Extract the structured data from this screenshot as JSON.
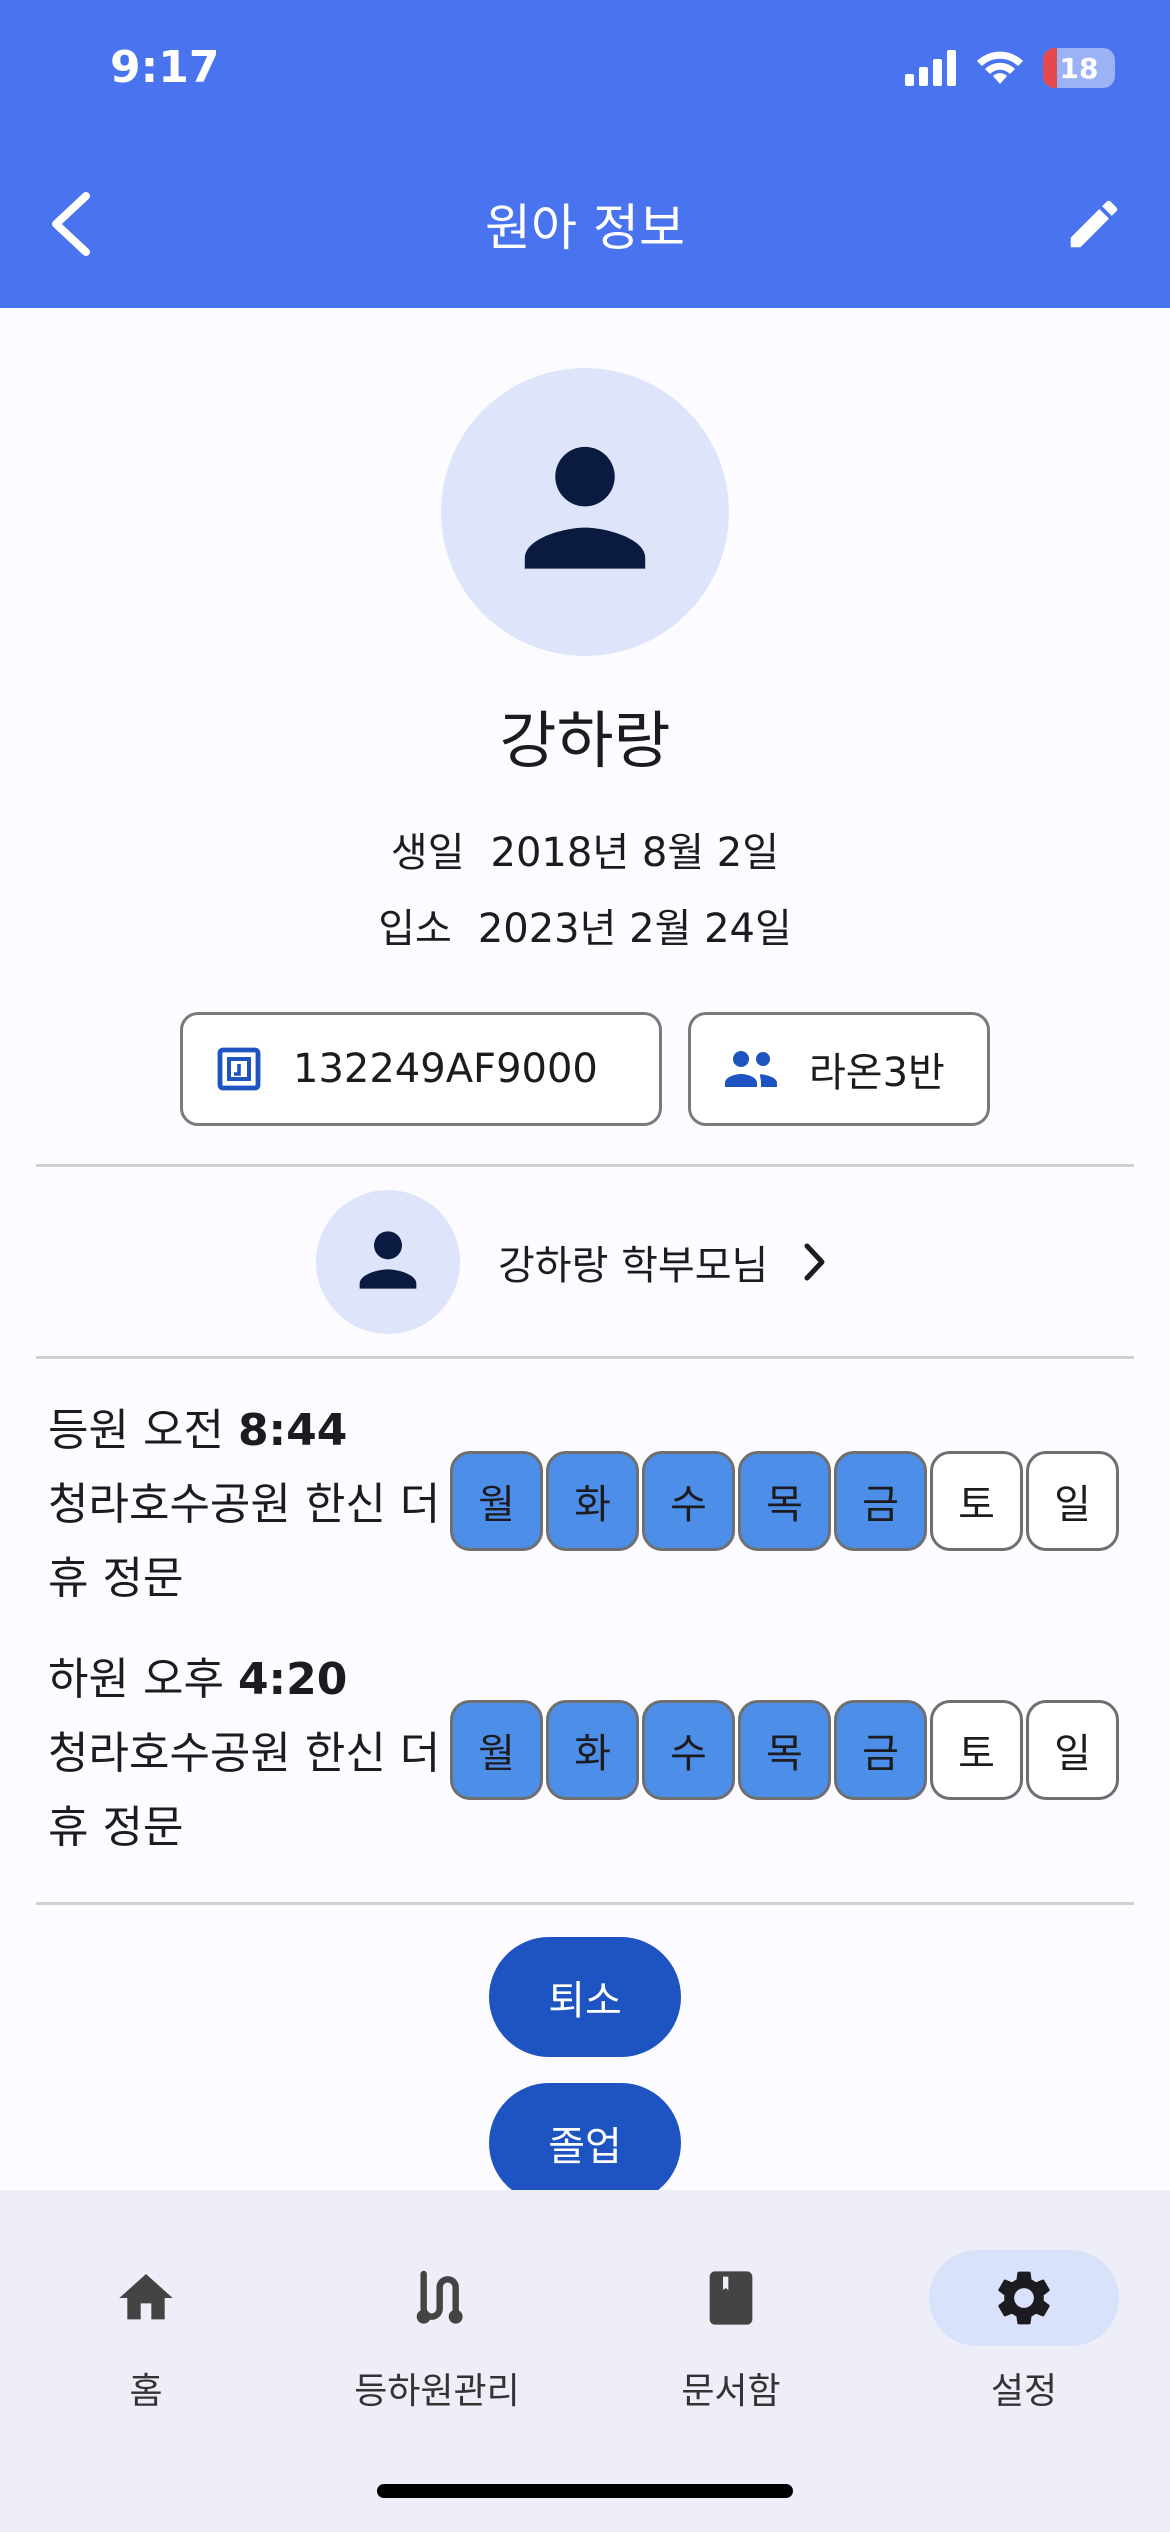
{
  "status_bar": {
    "time": "9:17",
    "battery": "18"
  },
  "header": {
    "title": "원아 정보"
  },
  "child": {
    "name": "강하랑",
    "birthday_label": "생일",
    "birthday": "2018년 8월 2일",
    "enroll_label": "입소",
    "enroll_date": "2023년 2월 24일",
    "tag_id": "132249AF9000",
    "class_name": "라온3반"
  },
  "parent": {
    "name": "강하랑 학부모님"
  },
  "schedules": [
    {
      "type": "등원",
      "period": "오전",
      "time": "8:44",
      "location": "청라호수공원 한신 더휴 정문",
      "days": [
        {
          "label": "월",
          "active": true
        },
        {
          "label": "화",
          "active": true
        },
        {
          "label": "수",
          "active": true
        },
        {
          "label": "목",
          "active": true
        },
        {
          "label": "금",
          "active": true
        },
        {
          "label": "토",
          "active": false
        },
        {
          "label": "일",
          "active": false
        }
      ]
    },
    {
      "type": "하원",
      "period": "오후",
      "time": "4:20",
      "location": "청라호수공원 한신 더휴 정문",
      "days": [
        {
          "label": "월",
          "active": true
        },
        {
          "label": "화",
          "active": true
        },
        {
          "label": "수",
          "active": true
        },
        {
          "label": "목",
          "active": true
        },
        {
          "label": "금",
          "active": true
        },
        {
          "label": "토",
          "active": false
        },
        {
          "label": "일",
          "active": false
        }
      ]
    }
  ],
  "actions": {
    "leave_label": "퇴소",
    "graduate_label": "졸업"
  },
  "bottom_nav": [
    {
      "label": "홈",
      "icon": "home-icon",
      "active": false
    },
    {
      "label": "등하원관리",
      "icon": "route-icon",
      "active": false
    },
    {
      "label": "문서함",
      "icon": "book-icon",
      "active": false
    },
    {
      "label": "설정",
      "icon": "gear-icon",
      "active": true
    }
  ],
  "colors": {
    "primary": "#4a74ef",
    "button": "#1e54c1",
    "day_active": "#4d8fe8",
    "avatar_bg": "#dee5fb"
  }
}
